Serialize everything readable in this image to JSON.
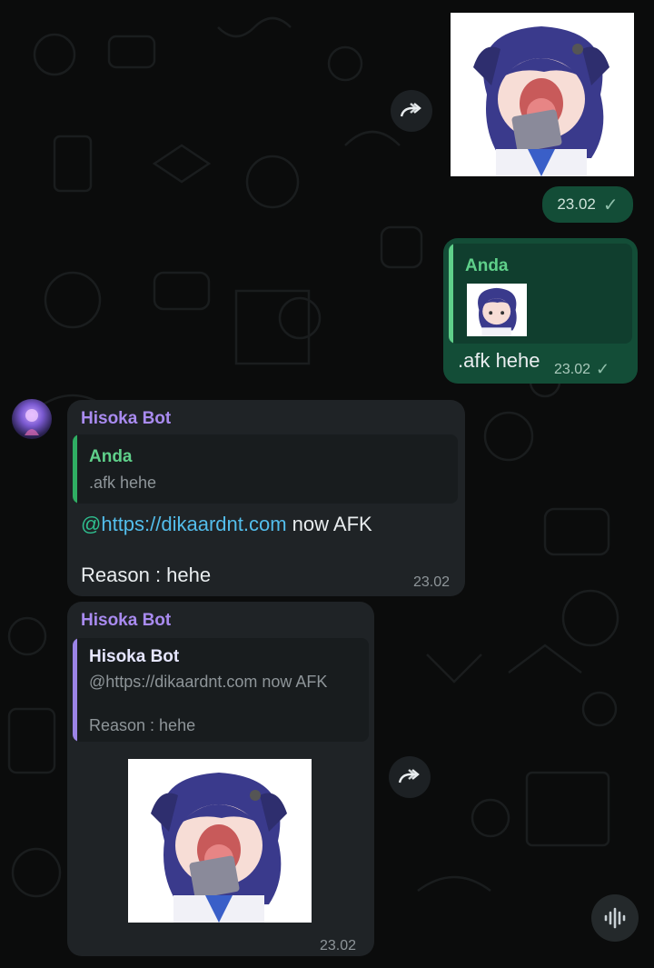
{
  "messages": [
    {
      "type": "sticker-out",
      "time": "23.02"
    },
    {
      "type": "reply-out",
      "quote_author": "Anda",
      "text": ".afk hehe",
      "time": "23.02"
    },
    {
      "type": "text-in",
      "sender": "Hisoka Bot",
      "quote_author": "Anda",
      "quote_text": ".afk hehe",
      "mention_at": "@",
      "link": "https://dikaardnt.com",
      "after_link": " now AFK",
      "reason": "Reason : hehe",
      "time": "23.02"
    },
    {
      "type": "sticker-in",
      "sender": "Hisoka Bot",
      "quote_author": "Hisoka Bot",
      "quote_line1": "@https://dikaardnt.com now AFK",
      "quote_line2": "Reason : hehe",
      "time": "23.02"
    }
  ],
  "icons": {
    "forward": "forward-icon",
    "check": "single-check-icon",
    "voice": "voice-wave-icon"
  },
  "glyphs": {
    "check": "✓"
  },
  "colors": {
    "background": "#0b0c0c",
    "outgoing_bubble": "#134d37",
    "incoming_bubble": "#1f2326",
    "sender_name": "#a98bf0",
    "quote_green": "#5fd08a",
    "link": "#53bdeb"
  }
}
